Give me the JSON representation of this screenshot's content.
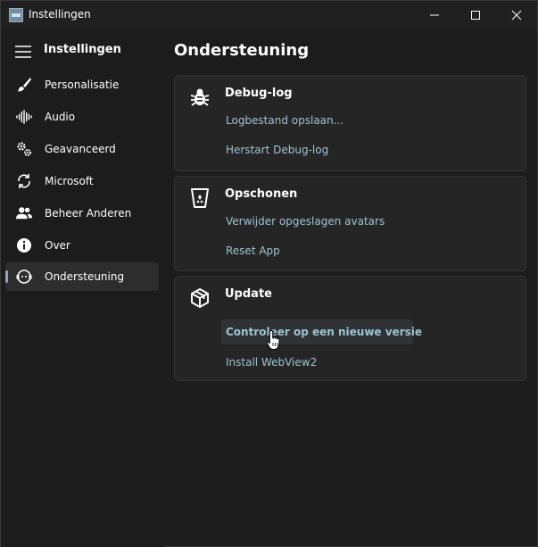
{
  "window": {
    "title": "Instellingen"
  },
  "sidebar": {
    "title": "Instellingen",
    "items": [
      {
        "label": "Personalisatie",
        "icon": "paintbrush-icon"
      },
      {
        "label": "Audio",
        "icon": "audio-wave-icon"
      },
      {
        "label": "Geavanceerd",
        "icon": "gears-icon"
      },
      {
        "label": "Microsoft",
        "icon": "sync-icon"
      },
      {
        "label": "Beheer Anderen",
        "icon": "users-icon"
      },
      {
        "label": "Over",
        "icon": "info-icon"
      },
      {
        "label": "Ondersteuning",
        "icon": "support-icon",
        "active": true
      }
    ]
  },
  "main": {
    "title": "Ondersteuning",
    "cards": [
      {
        "title": "Debug-log",
        "icon": "bug-icon",
        "links": [
          "Logbestand opslaan...",
          "Herstart Debug-log"
        ]
      },
      {
        "title": "Opschonen",
        "icon": "trash-icon",
        "links": [
          "Verwijder opgeslagen avatars",
          "Reset App"
        ]
      },
      {
        "title": "Update",
        "icon": "package-icon",
        "links": [
          "Controleer op een nieuwe versie",
          "Install WebView2"
        ]
      }
    ]
  },
  "colors": {
    "accent_link": "#9ec3d1",
    "background": "#1c1c1c",
    "card": "#252525"
  }
}
